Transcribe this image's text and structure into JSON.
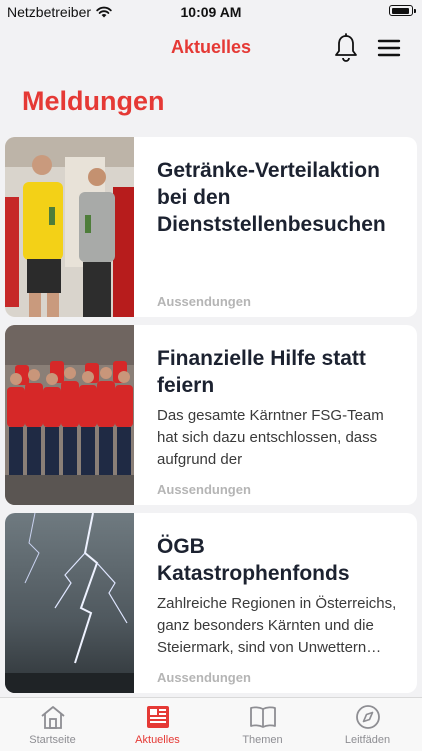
{
  "status": {
    "carrier": "Netzbetreiber",
    "time": "10:09 AM",
    "battery_level": 0.9
  },
  "nav": {
    "title": "Aktuelles",
    "bell_icon": "bell-icon",
    "menu_icon": "hamburger-menu-icon"
  },
  "section_title": "Meldungen",
  "articles": [
    {
      "title": "Getränke-Verteilaktion bei den Dienststellenbesuchen",
      "excerpt": "",
      "category": "Aussendungen",
      "image": "photo-two-people-holding-drinks"
    },
    {
      "title": "Finanzielle Hilfe statt feiern",
      "excerpt": "Das gesamte Kärntner FSG-Team hat sich dazu entschlossen, dass aufgrund der",
      "category": "Aussendungen",
      "image": "photo-team-in-red-shirts"
    },
    {
      "title": "ÖGB Katastrophenfonds",
      "excerpt": "Zahlreiche Regionen in Österreichs, ganz besonders Kärnten und die Steiermark, sind von Unwettern betroffen",
      "category": "Aussendungen",
      "image": "photo-lightning-storm"
    }
  ],
  "tabs": [
    {
      "label": "Startseite",
      "icon": "home-icon",
      "active": false
    },
    {
      "label": "Aktuelles",
      "icon": "newspaper-icon",
      "active": true
    },
    {
      "label": "Themen",
      "icon": "open-book-icon",
      "active": false
    },
    {
      "label": "Leitfäden",
      "icon": "compass-icon",
      "active": false
    }
  ],
  "colors": {
    "accent": "#e53935",
    "text": "#1c2230",
    "muted": "#b5b5b5",
    "inactive_tab": "#8e8e93"
  }
}
